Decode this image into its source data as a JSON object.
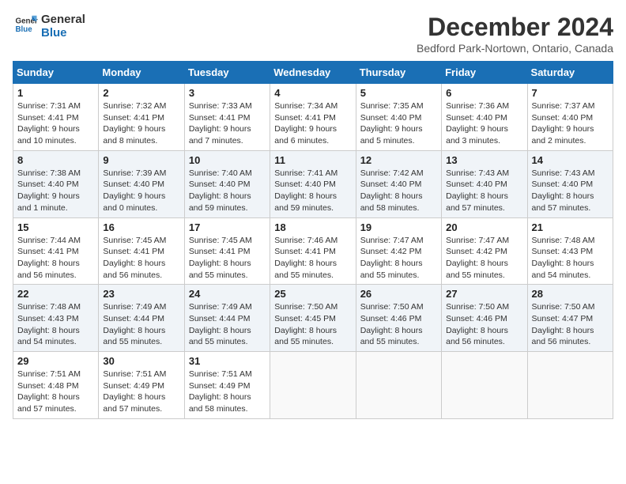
{
  "logo": {
    "line1": "General",
    "line2": "Blue"
  },
  "title": "December 2024",
  "location": "Bedford Park-Nortown, Ontario, Canada",
  "weekdays": [
    "Sunday",
    "Monday",
    "Tuesday",
    "Wednesday",
    "Thursday",
    "Friday",
    "Saturday"
  ],
  "weeks": [
    [
      {
        "day": "1",
        "sunrise": "Sunrise: 7:31 AM",
        "sunset": "Sunset: 4:41 PM",
        "daylight": "Daylight: 9 hours and 10 minutes."
      },
      {
        "day": "2",
        "sunrise": "Sunrise: 7:32 AM",
        "sunset": "Sunset: 4:41 PM",
        "daylight": "Daylight: 9 hours and 8 minutes."
      },
      {
        "day": "3",
        "sunrise": "Sunrise: 7:33 AM",
        "sunset": "Sunset: 4:41 PM",
        "daylight": "Daylight: 9 hours and 7 minutes."
      },
      {
        "day": "4",
        "sunrise": "Sunrise: 7:34 AM",
        "sunset": "Sunset: 4:41 PM",
        "daylight": "Daylight: 9 hours and 6 minutes."
      },
      {
        "day": "5",
        "sunrise": "Sunrise: 7:35 AM",
        "sunset": "Sunset: 4:40 PM",
        "daylight": "Daylight: 9 hours and 5 minutes."
      },
      {
        "day": "6",
        "sunrise": "Sunrise: 7:36 AM",
        "sunset": "Sunset: 4:40 PM",
        "daylight": "Daylight: 9 hours and 3 minutes."
      },
      {
        "day": "7",
        "sunrise": "Sunrise: 7:37 AM",
        "sunset": "Sunset: 4:40 PM",
        "daylight": "Daylight: 9 hours and 2 minutes."
      }
    ],
    [
      {
        "day": "8",
        "sunrise": "Sunrise: 7:38 AM",
        "sunset": "Sunset: 4:40 PM",
        "daylight": "Daylight: 9 hours and 1 minute."
      },
      {
        "day": "9",
        "sunrise": "Sunrise: 7:39 AM",
        "sunset": "Sunset: 4:40 PM",
        "daylight": "Daylight: 9 hours and 0 minutes."
      },
      {
        "day": "10",
        "sunrise": "Sunrise: 7:40 AM",
        "sunset": "Sunset: 4:40 PM",
        "daylight": "Daylight: 8 hours and 59 minutes."
      },
      {
        "day": "11",
        "sunrise": "Sunrise: 7:41 AM",
        "sunset": "Sunset: 4:40 PM",
        "daylight": "Daylight: 8 hours and 59 minutes."
      },
      {
        "day": "12",
        "sunrise": "Sunrise: 7:42 AM",
        "sunset": "Sunset: 4:40 PM",
        "daylight": "Daylight: 8 hours and 58 minutes."
      },
      {
        "day": "13",
        "sunrise": "Sunrise: 7:43 AM",
        "sunset": "Sunset: 4:40 PM",
        "daylight": "Daylight: 8 hours and 57 minutes."
      },
      {
        "day": "14",
        "sunrise": "Sunrise: 7:43 AM",
        "sunset": "Sunset: 4:40 PM",
        "daylight": "Daylight: 8 hours and 57 minutes."
      }
    ],
    [
      {
        "day": "15",
        "sunrise": "Sunrise: 7:44 AM",
        "sunset": "Sunset: 4:41 PM",
        "daylight": "Daylight: 8 hours and 56 minutes."
      },
      {
        "day": "16",
        "sunrise": "Sunrise: 7:45 AM",
        "sunset": "Sunset: 4:41 PM",
        "daylight": "Daylight: 8 hours and 56 minutes."
      },
      {
        "day": "17",
        "sunrise": "Sunrise: 7:45 AM",
        "sunset": "Sunset: 4:41 PM",
        "daylight": "Daylight: 8 hours and 55 minutes."
      },
      {
        "day": "18",
        "sunrise": "Sunrise: 7:46 AM",
        "sunset": "Sunset: 4:41 PM",
        "daylight": "Daylight: 8 hours and 55 minutes."
      },
      {
        "day": "19",
        "sunrise": "Sunrise: 7:47 AM",
        "sunset": "Sunset: 4:42 PM",
        "daylight": "Daylight: 8 hours and 55 minutes."
      },
      {
        "day": "20",
        "sunrise": "Sunrise: 7:47 AM",
        "sunset": "Sunset: 4:42 PM",
        "daylight": "Daylight: 8 hours and 55 minutes."
      },
      {
        "day": "21",
        "sunrise": "Sunrise: 7:48 AM",
        "sunset": "Sunset: 4:43 PM",
        "daylight": "Daylight: 8 hours and 54 minutes."
      }
    ],
    [
      {
        "day": "22",
        "sunrise": "Sunrise: 7:48 AM",
        "sunset": "Sunset: 4:43 PM",
        "daylight": "Daylight: 8 hours and 54 minutes."
      },
      {
        "day": "23",
        "sunrise": "Sunrise: 7:49 AM",
        "sunset": "Sunset: 4:44 PM",
        "daylight": "Daylight: 8 hours and 55 minutes."
      },
      {
        "day": "24",
        "sunrise": "Sunrise: 7:49 AM",
        "sunset": "Sunset: 4:44 PM",
        "daylight": "Daylight: 8 hours and 55 minutes."
      },
      {
        "day": "25",
        "sunrise": "Sunrise: 7:50 AM",
        "sunset": "Sunset: 4:45 PM",
        "daylight": "Daylight: 8 hours and 55 minutes."
      },
      {
        "day": "26",
        "sunrise": "Sunrise: 7:50 AM",
        "sunset": "Sunset: 4:46 PM",
        "daylight": "Daylight: 8 hours and 55 minutes."
      },
      {
        "day": "27",
        "sunrise": "Sunrise: 7:50 AM",
        "sunset": "Sunset: 4:46 PM",
        "daylight": "Daylight: 8 hours and 56 minutes."
      },
      {
        "day": "28",
        "sunrise": "Sunrise: 7:50 AM",
        "sunset": "Sunset: 4:47 PM",
        "daylight": "Daylight: 8 hours and 56 minutes."
      }
    ],
    [
      {
        "day": "29",
        "sunrise": "Sunrise: 7:51 AM",
        "sunset": "Sunset: 4:48 PM",
        "daylight": "Daylight: 8 hours and 57 minutes."
      },
      {
        "day": "30",
        "sunrise": "Sunrise: 7:51 AM",
        "sunset": "Sunset: 4:49 PM",
        "daylight": "Daylight: 8 hours and 57 minutes."
      },
      {
        "day": "31",
        "sunrise": "Sunrise: 7:51 AM",
        "sunset": "Sunset: 4:49 PM",
        "daylight": "Daylight: 8 hours and 58 minutes."
      },
      null,
      null,
      null,
      null
    ]
  ]
}
